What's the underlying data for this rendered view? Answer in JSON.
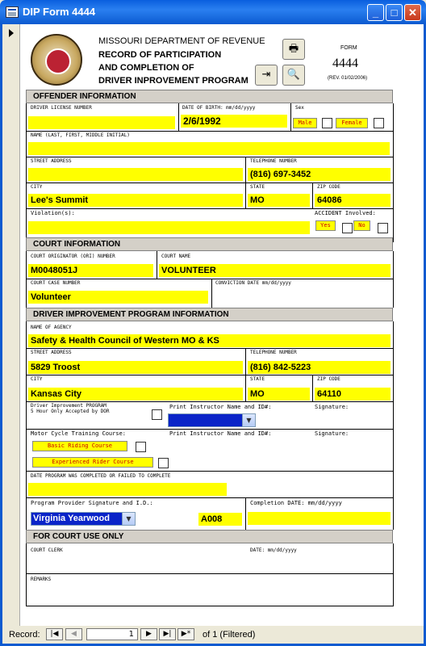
{
  "window": {
    "title": "DIP Form 4444"
  },
  "header": {
    "dept": "MISSOURI DEPARTMENT OF REVENUE",
    "line1": "RECORD OF PARTICIPATION",
    "line2": "AND COMPLETION OF",
    "line3": "DRIVER INPROVEMENT PROGRAM",
    "form_label": "FORM",
    "form_number": "4444",
    "form_rev": "(REV. 01/02/2006)"
  },
  "icons": {
    "print": "printer-icon",
    "exit": "exit-door-icon",
    "preview": "print-preview-icon"
  },
  "offender": {
    "section": "OFFENDER INFORMATION",
    "dl_label": "DRIVER LICENSE NUMBER",
    "dl_value": "",
    "dob_label": "DATE OF BIRTH: mm/dd/yyyy",
    "dob_value": "2/6/1992",
    "sex_label": "Sex",
    "male": "Male",
    "female": "Female",
    "name_label": "NAME (LAST, FIRST, MIDDLE INITIAL)",
    "name_value": "",
    "street_label": "STREET ADDRESS",
    "street_value": "",
    "phone_label": "TELEPHONE NUMBER",
    "phone_value": "(816) 697-3452",
    "city_label": "CITY",
    "city_value": "Lee's Summit",
    "state_label": "STATE",
    "state_value": "MO",
    "zip_label": "ZIP CODE",
    "zip_value": "64086",
    "violation_label": "Violation(s):",
    "violation_value": "",
    "accident_label": "ACCIDENT Involved:",
    "yes": "Yes",
    "no": "No"
  },
  "court": {
    "section": "COURT INFORMATION",
    "ori_label": "COURT ORIGINATOR (ORI) NUMBER",
    "ori_value": "M0048051J",
    "name_label": "COURT NAME",
    "name_value": "VOLUNTEER",
    "case_label": "COURT CASE NUMBER",
    "case_value": "Volunteer",
    "conv_label": "CONVICTION DATE mm/dd/yyyy",
    "conv_value": ""
  },
  "dip": {
    "section": "DRIVER IMPROVEMENT PROGRAM INFORMATION",
    "agency_label": "NAME OF AGENCY",
    "agency_value": "Safety & Health Council of Western MO & KS",
    "street_label": "STREET ADDRESS",
    "street_value": "5829 Troost",
    "phone_label": "TELEPHONE NUMBER",
    "phone_value": "(816) 842-5223",
    "city_label": "CITY",
    "city_value": "Kansas City",
    "state_label": "STATE",
    "state_value": "MO",
    "zip_label": "ZIP CODE",
    "zip_value": "64110",
    "program_label_1": "Driver Improvement PROGRAM",
    "program_label_2": "5 Hour Only Accepted by DOR",
    "instructor_label": "Print Instructor Name and ID#:",
    "signature_label": "Signature:",
    "moto_label": "Motor Cycle Training Course:",
    "basic": "Basic Riding Course",
    "experienced": "Experienced Rider Course",
    "date_label": "DATE PROGRAM WAS COMPLETED OR FAILED TO COMPLETE",
    "provider_label": "Program Provider Signature and I.D.:",
    "provider_value": "Virginia Yearwood",
    "provider_id": "A008",
    "completion_label": "Completion DATE: mm/dd/yyyy"
  },
  "court_use": {
    "section": "FOR COURT USE ONLY",
    "clerk_label": "COURT CLERK",
    "date_label": "DATE: mm/dd/yyyy",
    "remarks_label": "REMARKS"
  },
  "nav": {
    "record_label": "Record:",
    "current": "1",
    "of_text": "of  1 (Filtered)"
  }
}
